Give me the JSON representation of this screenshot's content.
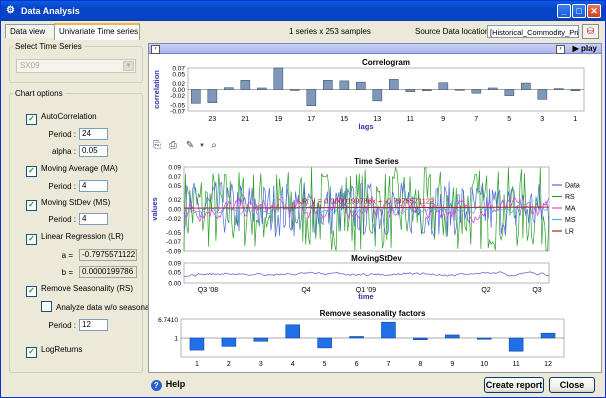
{
  "window": {
    "title": "Data Analysis"
  },
  "tabs": [
    {
      "label": "Data view"
    },
    {
      "label": "Univariate Time series"
    }
  ],
  "status": {
    "series_count": "1 series  x  253 samples",
    "source_label": "Source Data location :",
    "source_value": "[Historical_Commodity_Prices"
  },
  "left": {
    "select_label": "Select Time Series",
    "select_value": "SX09",
    "chart_options_label": "Chart options",
    "autocorr": {
      "label": "AutoCorrelation",
      "checked": true,
      "period_label": "Period :",
      "period": "24",
      "alpha_label": "alpha :",
      "alpha": "0.05"
    },
    "ma": {
      "label": "Moving Average (MA)",
      "checked": true,
      "period_label": "Period :",
      "period": "4"
    },
    "ms": {
      "label": "Moving StDev (MS)",
      "checked": true,
      "period_label": "Period :",
      "period": "4"
    },
    "lr": {
      "label": "Linear Regression (LR)",
      "checked": true,
      "a_label": "a =",
      "a": "-0.7975571122",
      "b_label": "b =",
      "b": "0.0000199786"
    },
    "rs": {
      "label": "Remove Seasonality (RS)",
      "checked": true,
      "wo_label": "Analyze data w/o seasonality",
      "wo_checked": false,
      "period_label": "Period :",
      "period": "12"
    },
    "logreturns": {
      "label": "LogReturns",
      "checked": true
    }
  },
  "playbar": {
    "label": "play"
  },
  "buttons": {
    "help": "Help",
    "report": "Create report",
    "close": "Close"
  },
  "icons": [
    "app-icon",
    "minimize-icon",
    "maximize-icon",
    "close-icon",
    "browse-icon",
    "copy-icon",
    "print-icon",
    "chart-edit-icon",
    "dropdown-icon",
    "zoom-icon",
    "help-icon"
  ],
  "chart_data": [
    {
      "type": "bar",
      "title": "Correlogram",
      "xlabel": "lags",
      "ylabel": "correlation",
      "ylim": [
        -0.07,
        0.07
      ],
      "yticks": [
        "0.07",
        "0.05",
        "0.02",
        "0.00",
        "-0.02",
        "-0.05",
        "-0.07"
      ],
      "categories": [
        "24",
        "23",
        "22",
        "21",
        "20",
        "19",
        "18",
        "17",
        "16",
        "15",
        "14",
        "13",
        "12",
        "11",
        "10",
        "9",
        "8",
        "7",
        "6",
        "5",
        "4",
        "3",
        "2",
        "1"
      ],
      "xtick_labels": [
        "23",
        "21",
        "19",
        "17",
        "15",
        "13",
        "11",
        "9",
        "7",
        "5",
        "3",
        "1"
      ],
      "values": [
        -0.045,
        -0.043,
        0.006,
        0.03,
        0.005,
        0.07,
        -0.003,
        -0.053,
        0.03,
        0.028,
        0.024,
        -0.037,
        0.033,
        -0.007,
        -0.004,
        0.022,
        -0.002,
        -0.012,
        0.005,
        -0.02,
        0.021,
        -0.032,
        0.003,
        -0.004
      ],
      "color": "#7f97b8"
    },
    {
      "type": "line",
      "title": "Time Series",
      "ylabel": "values",
      "ylim": [
        -0.09,
        0.09
      ],
      "yticks": [
        "0.09",
        "0.07",
        "0.05",
        "0.02",
        "0.00",
        "-0.02",
        "-0.05",
        "-0.07",
        "-0.09"
      ],
      "annotation": "LR: y = 0.0000199786x + -0.7975571122",
      "legend": [
        {
          "name": "Data",
          "color": "#4c6cd8"
        },
        {
          "name": "RS",
          "color": "#2b9e2b"
        },
        {
          "name": "MA",
          "color": "#d94ad9"
        },
        {
          "name": "MS",
          "color": "#4db8c8"
        },
        {
          "name": "LR",
          "color": "#b02020"
        }
      ]
    },
    {
      "type": "line",
      "title": "MovingStDev",
      "xlabel": "time",
      "ylim": [
        0.0,
        0.09
      ],
      "yticks": [
        "0.09",
        "0.05",
        "0.00"
      ],
      "xtick_labels": [
        "Q3 '08",
        "Q4",
        "Q1 '09",
        "Q2",
        "Q3"
      ],
      "series": [
        {
          "color": "#6a6ad8"
        }
      ]
    },
    {
      "type": "bar",
      "title": "Remove seasonality factors",
      "ylim": [
        0,
        6.741
      ],
      "yticks": [
        "6.7410",
        "1"
      ],
      "categories": [
        "1",
        "2",
        "3",
        "4",
        "5",
        "6",
        "7",
        "8",
        "9",
        "10",
        "11",
        "12"
      ],
      "values": [
        -0.55,
        -0.38,
        -0.15,
        0.6,
        -0.45,
        0.07,
        0.72,
        -0.08,
        0.14,
        -0.06,
        -0.6,
        0.22
      ],
      "color": "#1f6fe8"
    }
  ]
}
